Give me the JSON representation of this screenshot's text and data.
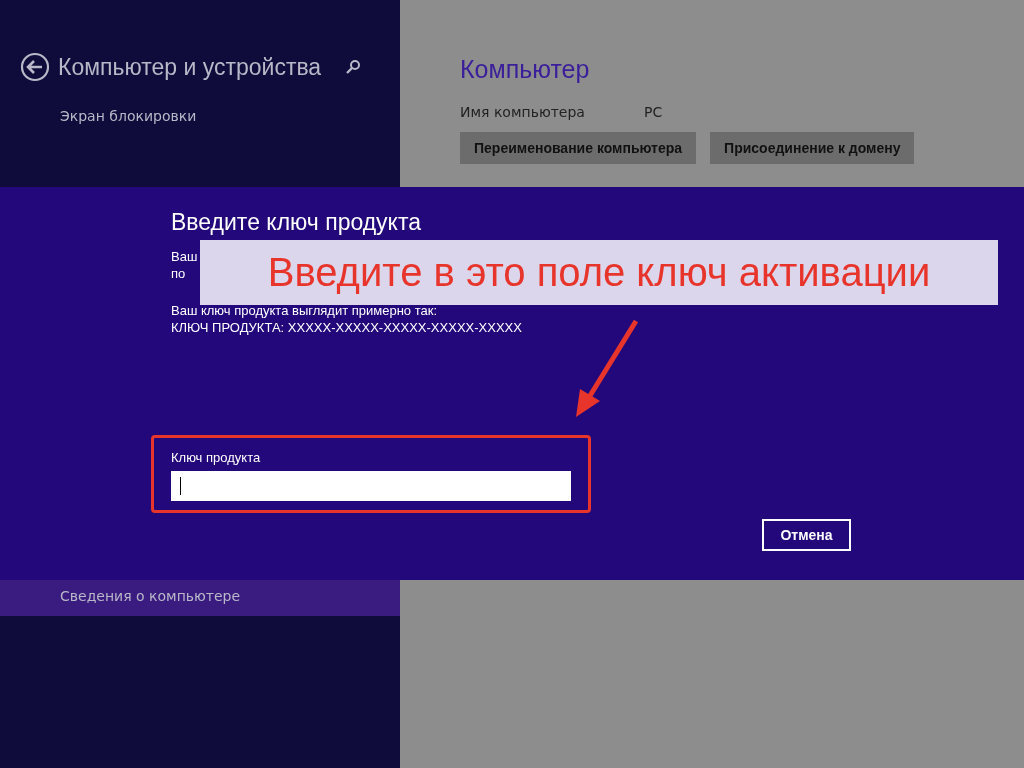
{
  "sidebar": {
    "title": "Компьютер и устройства",
    "items": [
      {
        "label": "Экран блокировки",
        "selected": false
      },
      {
        "label": "Сведения о компьютере",
        "selected": true
      }
    ]
  },
  "main": {
    "heading": "Компьютер",
    "name_label": "Имя компьютера",
    "name_value": "PC",
    "buttons": [
      "Переименование компьютера",
      "Присоединение к домену"
    ]
  },
  "dialog": {
    "title": "Введите ключ продукта",
    "description": [
      "Ваш",
      "по"
    ],
    "example": [
      "Ваш ключ продукта выглядит примерно так:",
      "КЛЮЧ ПРОДУКТА: XXXXX-XXXXX-XXXXX-XXXXX-XXXXX"
    ],
    "field_label": "Ключ продукта",
    "cancel": "Отмена"
  },
  "annotation": {
    "callout": "Введите в это поле ключ активации"
  }
}
